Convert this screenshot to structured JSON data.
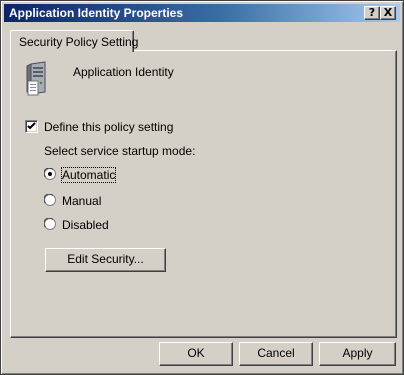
{
  "window": {
    "title": "Application Identity Properties",
    "help_button": "?",
    "close_button": "X"
  },
  "tab": {
    "label": "Security Policy Setting"
  },
  "service": {
    "name": "Application Identity",
    "icon": "server-icon"
  },
  "define_policy": {
    "label": "Define this policy setting",
    "checked": true
  },
  "startup_mode": {
    "label": "Select service startup mode:",
    "options": [
      {
        "label": "Automatic",
        "selected": true
      },
      {
        "label": "Manual",
        "selected": false
      },
      {
        "label": "Disabled",
        "selected": false
      }
    ]
  },
  "buttons": {
    "edit_security": "Edit Security...",
    "ok": "OK",
    "cancel": "Cancel",
    "apply": "Apply"
  },
  "colors": {
    "title_bar_start": "#0a246a",
    "title_bar_end": "#a6caf0",
    "face": "#d4d0c8"
  }
}
